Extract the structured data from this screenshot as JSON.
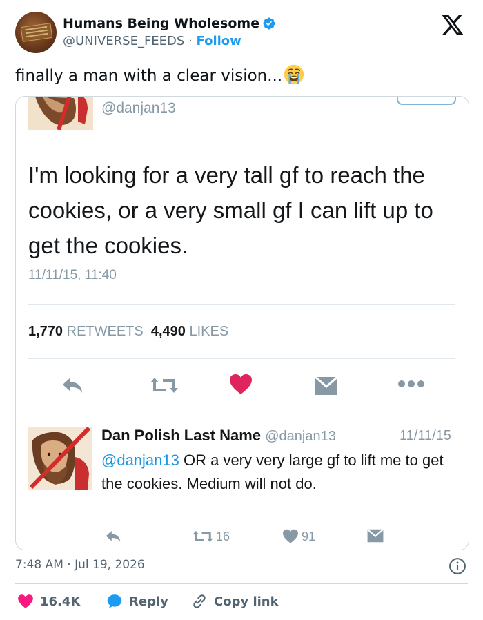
{
  "account": {
    "name": "Humans Being Wholesome",
    "handle": "@UNIVERSE_FEEDS",
    "separator": "·",
    "follow_label": "Follow"
  },
  "tweet": {
    "text": "finally a man with a clear vision...",
    "emoji": "crying-face-emoji"
  },
  "embedded": {
    "original": {
      "handle": "@danjan13",
      "text": "I'm looking for a very tall gf to reach the cookies, or a very small gf I can lift up to get the cookies.",
      "date": "11/11/15, 11:40",
      "retweets_count": "1,770",
      "retweets_label": "RETWEETS",
      "likes_count": "4,490",
      "likes_label": "LIKES"
    },
    "reply": {
      "name": "Dan Polish Last Name",
      "handle": "@danjan13",
      "date": "11/11/15",
      "mention": "@danjan13",
      "text": " OR a very very large gf to lift me to get the cookies. Medium will not do.",
      "retweets": "16",
      "likes": "91"
    }
  },
  "footer": {
    "timestamp": "7:48 AM · Jul 19, 2026",
    "likes": "16.4K",
    "reply_label": "Reply",
    "copy_label": "Copy link"
  },
  "colors": {
    "like": "#f91880",
    "link": "#1d9bf0",
    "heart_red": "#e0245e"
  }
}
